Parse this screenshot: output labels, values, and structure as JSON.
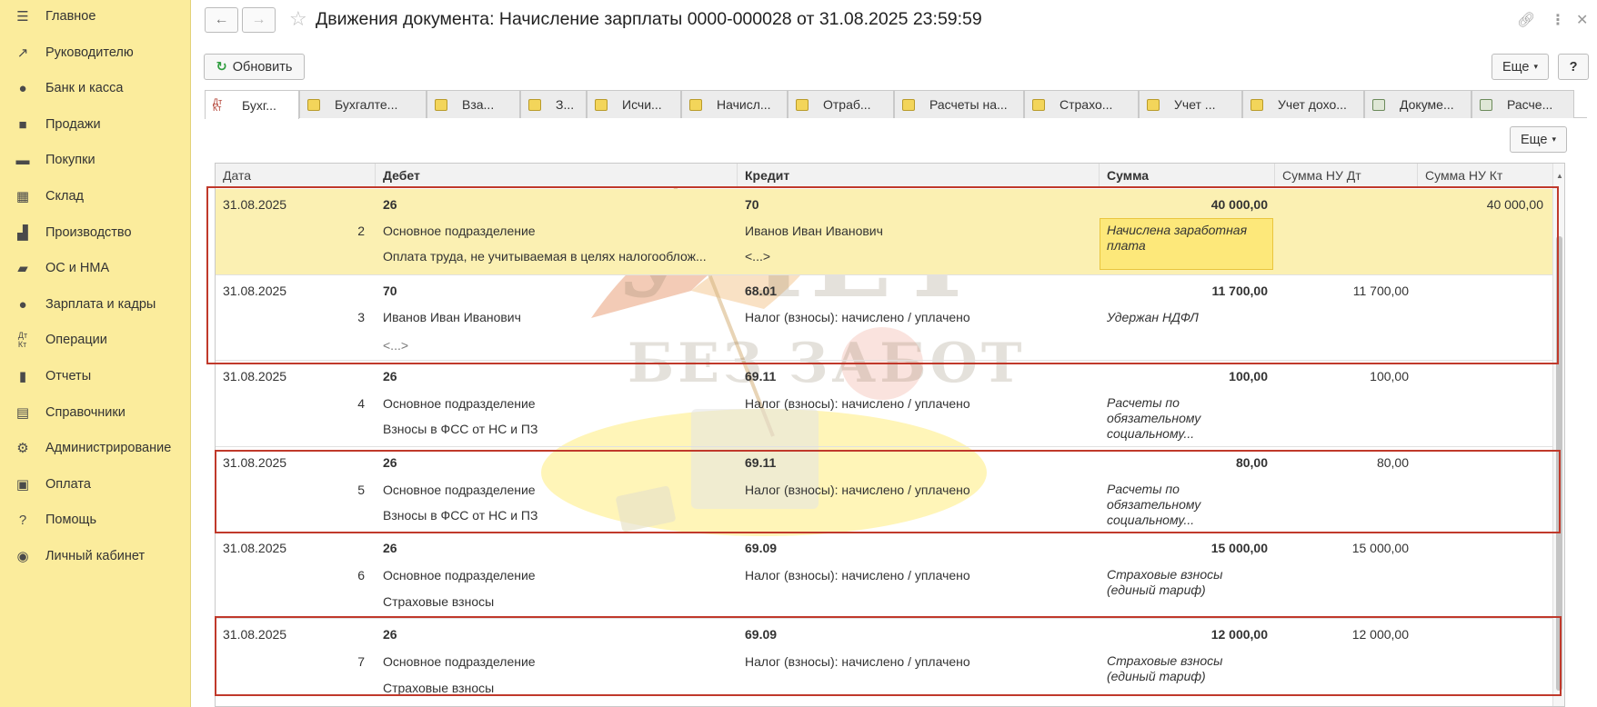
{
  "sidebar": {
    "items": [
      {
        "label": "Главное",
        "icon": "menu-icon"
      },
      {
        "label": "Руководителю",
        "icon": "trend-icon"
      },
      {
        "label": "Банк и касса",
        "icon": "coins-icon"
      },
      {
        "label": "Продажи",
        "icon": "bag-icon"
      },
      {
        "label": "Покупки",
        "icon": "cart-icon"
      },
      {
        "label": "Склад",
        "icon": "warehouse-icon"
      },
      {
        "label": "Производство",
        "icon": "factory-icon"
      },
      {
        "label": "ОС и НМА",
        "icon": "truck-icon"
      },
      {
        "label": "Зарплата и кадры",
        "icon": "person-icon"
      },
      {
        "label": "Операции",
        "icon": "dt-kt-icon"
      },
      {
        "label": "Отчеты",
        "icon": "bar-chart-icon"
      },
      {
        "label": "Справочники",
        "icon": "books-icon"
      },
      {
        "label": "Администрирование",
        "icon": "gear-icon"
      },
      {
        "label": "Оплата",
        "icon": "wallet-icon"
      },
      {
        "label": "Помощь",
        "icon": "question-icon"
      },
      {
        "label": "Личный кабинет",
        "icon": "user-circle-icon"
      }
    ]
  },
  "header": {
    "title": "Движения документа: Начисление зарплаты 0000-000028 от 31.08.2025 23:59:59"
  },
  "toolbar": {
    "refresh_label": "Обновить",
    "more_label": "Еще",
    "help_label": "?",
    "inner_more_label": "Еще"
  },
  "tabs": [
    {
      "label": "Бухг..."
    },
    {
      "label": "Бухгалте..."
    },
    {
      "label": "Вза..."
    },
    {
      "label": "З..."
    },
    {
      "label": "Исчи..."
    },
    {
      "label": "Начисл..."
    },
    {
      "label": "Отраб..."
    },
    {
      "label": "Расчеты на..."
    },
    {
      "label": "Страхо..."
    },
    {
      "label": "Учет ..."
    },
    {
      "label": "Учет дохо..."
    },
    {
      "label": "Докуме..."
    },
    {
      "label": "Расче..."
    }
  ],
  "table": {
    "columns": [
      "Дата",
      "Дебет",
      "Кредит",
      "Сумма",
      "Сумма НУ Дт",
      "Сумма НУ Кт"
    ],
    "rows": [
      {
        "date": "31.08.2025",
        "num": "",
        "debit": "26",
        "debit_sub1": "Основное подразделение",
        "debit_sub2": "Оплата труда, не учитываемая в целях налогооблож...",
        "credit": "70",
        "credit_sub1": "Иванов Иван Иванович",
        "credit_sub2": "<...>",
        "sum": "40 000,00",
        "description": "Начислена заработная плата",
        "nu_dt": "",
        "nu_kt": "40 000,00"
      },
      {
        "date": "31.08.2025",
        "num": "3",
        "debit": "70",
        "debit_sub1": "Иванов Иван Иванович",
        "debit_sub2": "<...>",
        "credit": "68.01",
        "credit_sub1": "Налог (взносы): начислено / уплачено",
        "credit_sub2": "",
        "sum": "11 700,00",
        "description": "Удержан НДФЛ",
        "nu_dt": "11 700,00",
        "nu_kt": ""
      },
      {
        "date": "31.08.2025",
        "num": "4",
        "debit": "26",
        "debit_sub1": "Основное подразделение",
        "debit_sub2": "Взносы в ФСС от НС и ПЗ",
        "credit": "69.11",
        "credit_sub1": "Налог (взносы): начислено / уплачено",
        "credit_sub2": "",
        "sum": "100,00",
        "description": "Расчеты по обязательному социальному...",
        "nu_dt": "100,00",
        "nu_kt": ""
      },
      {
        "date": "31.08.2025",
        "num": "5",
        "debit": "26",
        "debit_sub1": "Основное подразделение",
        "debit_sub2": "Взносы в ФСС от НС и ПЗ",
        "credit": "69.11",
        "credit_sub1": "Налог (взносы): начислено / уплачено",
        "credit_sub2": "",
        "sum": "80,00",
        "description": "Расчеты по обязательному социальному...",
        "nu_dt": "80,00",
        "nu_kt": ""
      },
      {
        "date": "31.08.2025",
        "num": "6",
        "debit": "26",
        "debit_sub1": "Основное подразделение",
        "debit_sub2": "Страховые взносы",
        "credit": "69.09",
        "credit_sub1": "Налог (взносы): начислено / уплачено",
        "credit_sub2": "",
        "sum": "15 000,00",
        "description": "Страховые взносы (единый тариф)",
        "nu_dt": "15 000,00",
        "nu_kt": ""
      },
      {
        "date": "31.08.2025",
        "num": "7",
        "debit": "26",
        "debit_sub1": "Основное подразделение",
        "debit_sub2": "Страховые взносы",
        "credit": "69.09",
        "credit_sub1": "Налог (взносы): начислено / уплачено",
        "credit_sub2": "",
        "sum": "12 000,00",
        "description": "Страховые взносы (единый тариф)",
        "nu_dt": "12 000,00",
        "nu_kt": ""
      }
    ],
    "row1_num": "2"
  },
  "watermark": {
    "line1": "УЧЕТ",
    "line2": "БЕЗ ЗАБОТ"
  },
  "colors": {
    "sidebar_bg": "#fbec9c",
    "selected_row": "#fbf0b2",
    "highlight_border": "#c0392b",
    "refresh_icon": "#2e9d3e"
  }
}
